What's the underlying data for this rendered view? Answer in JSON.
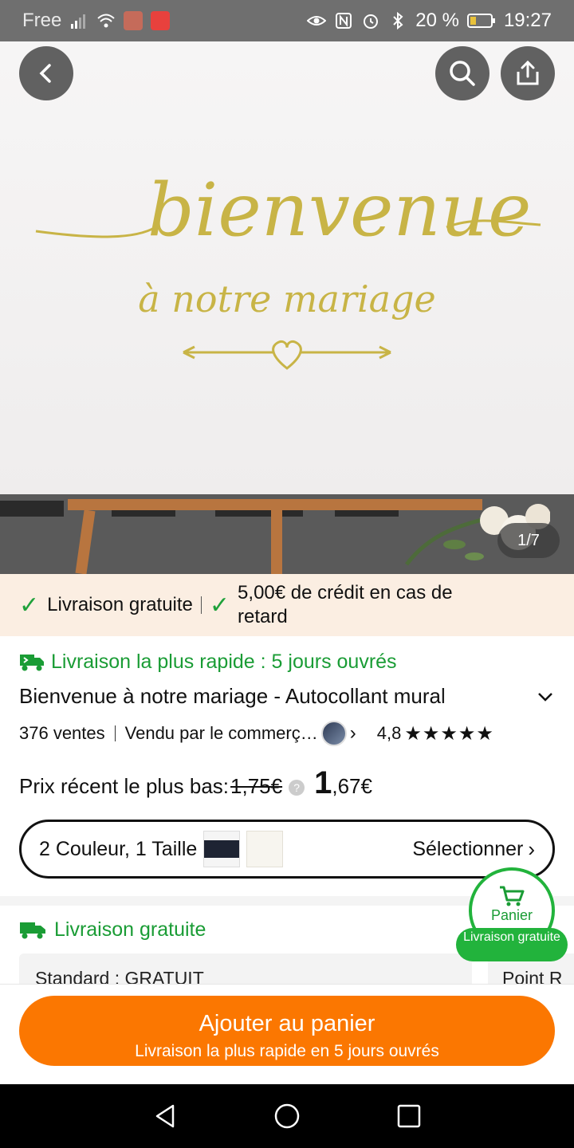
{
  "status_bar": {
    "carrier": "Free",
    "battery": "20 %",
    "time": "19:27"
  },
  "hero": {
    "image_text_line1": "bienvenue",
    "image_text_line2": "à notre mariage",
    "counter": "1/7"
  },
  "promo": {
    "item1": "Livraison gratuite",
    "item2": "5,00€ de crédit en cas de retard"
  },
  "product": {
    "fast_delivery": "Livraison la plus rapide : 5 jours ouvrés",
    "title": "Bienvenue à notre mariage - Autocollant mural",
    "sales": "376 ventes",
    "seller": "Vendu par le commerç…",
    "rating": "4,8",
    "stars": "★★★★★",
    "price_label": "Prix récent le plus bas:",
    "old_price": "1,75€",
    "price_int": "1",
    "price_dec": ",67€",
    "variant_text": "2 Couleur, 1 Taille",
    "variant_action": "Sélectionner"
  },
  "shipping": {
    "heading": "Livraison gratuite",
    "standard": "Standard : GRATUIT",
    "point": "Point R"
  },
  "cart_float": {
    "label": "Panier",
    "badge": "Livraison gratuite"
  },
  "bottom": {
    "add_label": "Ajouter au panier",
    "add_sub": "Livraison la plus rapide en 5 jours ouvrés"
  },
  "colors": {
    "accent_orange": "#fb7701",
    "green": "#1a9c35",
    "promo_bg": "#fbeee2"
  }
}
